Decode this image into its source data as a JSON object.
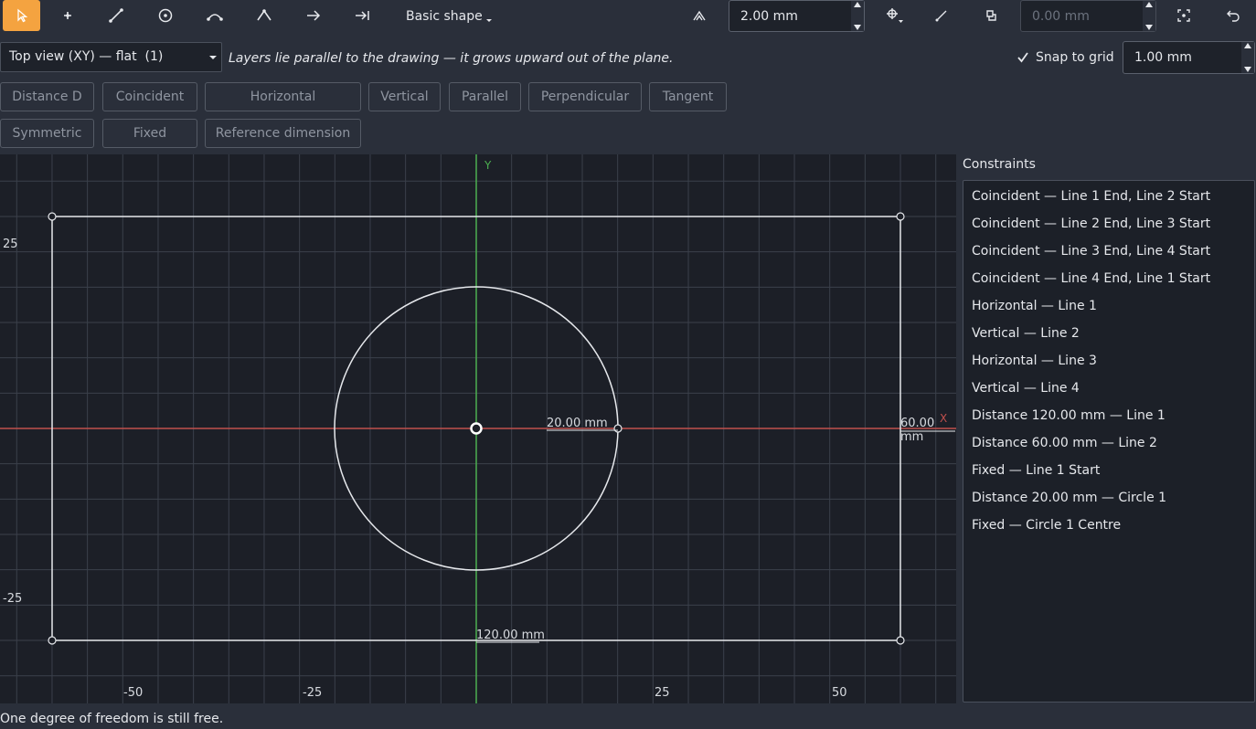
{
  "toolbar": {
    "tools": [
      {
        "name": "select-tool",
        "icon": "cursor-icon",
        "active": true
      },
      {
        "name": "point-tool",
        "icon": "point-icon"
      },
      {
        "name": "line-tool",
        "icon": "line-icon"
      },
      {
        "name": "circle-tool",
        "icon": "circle-icon"
      },
      {
        "name": "arc-tool",
        "icon": "arc-icon"
      },
      {
        "name": "polyline-tool",
        "icon": "polyline-icon"
      },
      {
        "name": "arrow-tool",
        "icon": "arrow-right-icon"
      },
      {
        "name": "dimension-tool",
        "icon": "arrow-to-line-icon"
      }
    ],
    "shape_dropdown_label": "Basic shape",
    "offset_value": "2.00 mm",
    "disabled_value": "0.00 mm"
  },
  "viewbar": {
    "view_select": "Top view (XY) — flat  (1)",
    "hint": "Layers lie parallel to the drawing — it grows upward out of the plane.",
    "snap_label": "Snap to grid",
    "snap_checked": true,
    "grid_value": "1.00 mm"
  },
  "constraint_buttons": {
    "row1": [
      "Distance  D",
      "Coincident",
      "Horizontal",
      "Vertical",
      "Parallel",
      "Perpendicular",
      "Tangent"
    ],
    "row2": [
      "Symmetric",
      "Fixed",
      "Reference dimension"
    ]
  },
  "canvas": {
    "axis_y": "Y",
    "axis_x": "X",
    "tick_labels_x": [
      "-50",
      "-25",
      "25",
      "50"
    ],
    "tick_labels_y": [
      "25",
      "-25"
    ],
    "dim_circle": "20.00 mm",
    "dim_height": "60.00 mm",
    "dim_width": "120.00 mm",
    "axis_x_color": "#c0504d",
    "axis_y_color": "#4caf50"
  },
  "constraints_panel": {
    "title": "Constraints",
    "items": [
      "Coincident — Line 1 End, Line 2 Start",
      "Coincident — Line 2 End, Line 3 Start",
      "Coincident — Line 3 End, Line 4 Start",
      "Coincident — Line 4 End, Line 1 Start",
      "Horizontal — Line 1",
      "Vertical — Line 2",
      "Horizontal — Line 3",
      "Vertical — Line 4",
      "Distance 120.00 mm — Line 1",
      "Distance 60.00 mm — Line 2",
      "Fixed — Line 1 Start",
      "Distance 20.00 mm — Circle 1",
      "Fixed — Circle 1 Centre"
    ]
  },
  "status": "One degree of freedom is still free."
}
